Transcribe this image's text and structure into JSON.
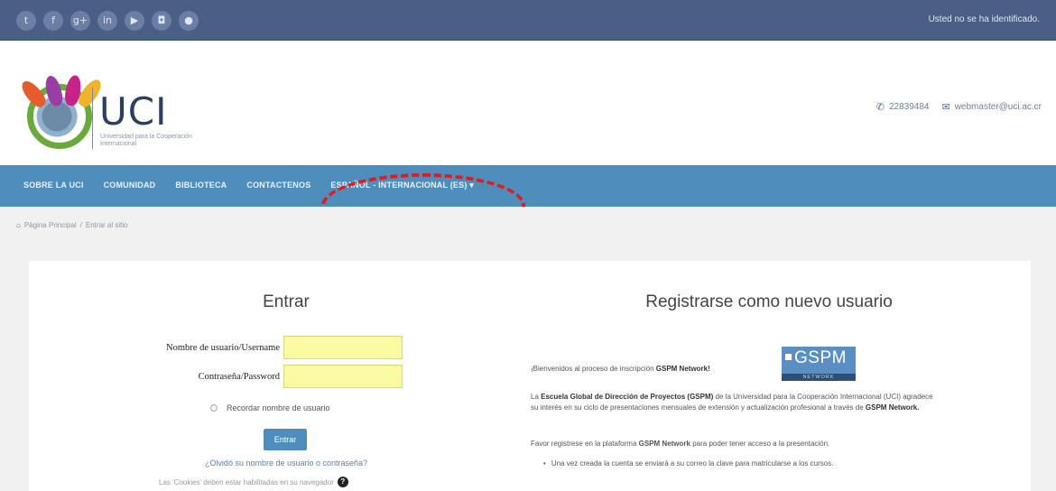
{
  "topbar": {
    "social_icons": [
      {
        "icon": "twitter-icon",
        "glyph": "t"
      },
      {
        "icon": "facebook-icon",
        "glyph": "f"
      },
      {
        "icon": "google-plus-icon",
        "glyph": "g+"
      },
      {
        "icon": "linkedin-icon",
        "glyph": "in"
      },
      {
        "icon": "youtube-icon",
        "glyph": "▶"
      },
      {
        "icon": "instagram-icon",
        "glyph": "◘"
      },
      {
        "icon": "flickr-icon",
        "glyph": "●"
      }
    ],
    "login_status": "Usted no se ha identificado."
  },
  "header": {
    "logo_text": "UCI",
    "logo_subtitle": "Universidad para la Cooperación Internacional",
    "phone": "22839484",
    "email": "webmaster@uci.ac.cr"
  },
  "nav": {
    "items": [
      "SOBRE LA UCI",
      "COMUNIDAD",
      "BIBLIOTECA",
      "CONTACTENOS",
      "ESPAÑOL - INTERNACIONAL (ES) ▾"
    ]
  },
  "breadcrumb": {
    "home": "Página Principal",
    "separator": "/",
    "current": "Entrar al sitio"
  },
  "login": {
    "title": "Entrar",
    "username_label": "Nombre de usuario/Username",
    "password_label": "Contraseña/Password",
    "remember_label": "Recordar nombre de usuario",
    "submit_label": "Entrar",
    "forgot_link": "¿Olvidó su nombre de usuario o contraseña?",
    "cookies_note": "Las 'Cookies' deben estar habilitadas en su navegador",
    "help_glyph": "?"
  },
  "register": {
    "title": "Registrarse como nuevo usuario",
    "welcome_prefix": "¡Bienvenidos al proceso de inscripción",
    "welcome_brand": "GSPM Network!",
    "para_intro": "La",
    "para_school": "Escuela Global de Dirección de Proyectos (GSPM)",
    "para_rest": "de la Universidad para la Cooperación Internacional (UCI) agradece su interés en su ciclo de presentaciones mensuales de extensión y actualización profesional a través de",
    "para_brand": "GSPM Network.",
    "para2_prefix": "Favor registrese en la plataforma",
    "para2_brand": "GSPM Network",
    "para2_suffix": "para poder tener acceso a la presentación.",
    "bullet": "Una vez creada la cuenta se enviará a su correo la clave para matricularse a los cursos.",
    "gspm_logo_text": "GSPM",
    "gspm_logo_sub": "NETWORK"
  },
  "colors": {
    "topbar": "#4a5f86",
    "navbar": "#4f8dbd",
    "field": "#fafaa0",
    "highlight": "#e31b1b"
  }
}
